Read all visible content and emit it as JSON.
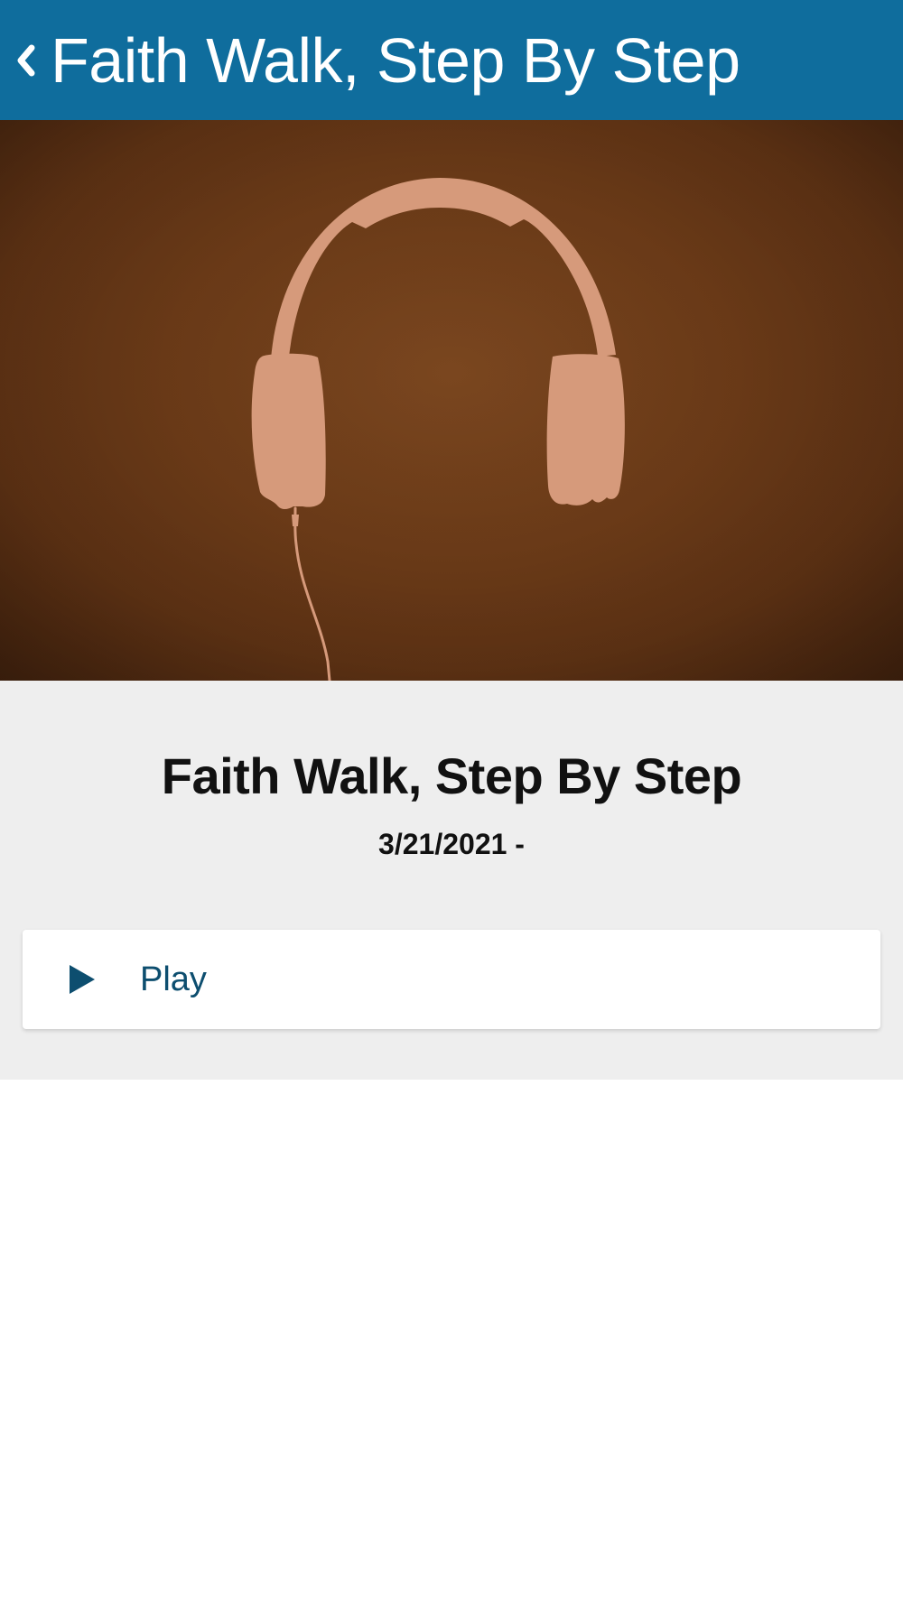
{
  "header": {
    "back_icon": "chevron-left-icon",
    "title": "Faith Walk, Step By Step"
  },
  "hero": {
    "image": "headphones-artwork",
    "colors": {
      "background": "#6e3c18",
      "headphones": "#d69a7b"
    }
  },
  "sermon": {
    "title": "Faith Walk, Step By Step",
    "date": "3/21/2021 -"
  },
  "player": {
    "play_icon": "play-icon",
    "play_label": "Play"
  },
  "colors": {
    "header": "#0f6d9d",
    "details_background": "#eeeeee",
    "play_accent": "#0d4e6f"
  }
}
